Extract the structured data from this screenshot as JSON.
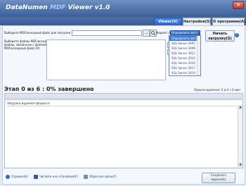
{
  "window": {
    "title_part1": "DataNumen ",
    "title_part2": "MDF",
    "title_part3": " Viewer v1.0",
    "close_label": "✕"
  },
  "tabs": [
    {
      "label": "Viewer(V)",
      "active": true
    },
    {
      "label": "Настройки(S)",
      "active": false
    },
    {
      "label": "О программе(A)",
      "active": false
    }
  ],
  "source": {
    "file_label": "Выберите MDF/исходный файл для загрузки (M):",
    "file_value": "",
    "browse_label": "...",
    "list_label_1": "Выберите файлы MDF/исходные",
    "list_label_2": "файлы, связанные с файлом",
    "list_label_3": "MDF/исходный файл (R):"
  },
  "format": {
    "label": "Формат (F):",
    "selected": "Определить авто",
    "options": [
      "Определить авто",
      "SQL Server 2005",
      "SQL Server 2008",
      "SQL Server 2012",
      "SQL Server 2014",
      "SQL Server 2016",
      "SQL Server 2017",
      "SQL Server 2019"
    ]
  },
  "actions": {
    "start_line1": "Начать",
    "start_line2": "загрузку(S)",
    "help_symbol": "?"
  },
  "progress": {
    "stage_text": "Этап 0 из 6 :  0% завершено",
    "time_text": "Прошло времени: 0 д 0 ч 0 мин",
    "percent": 0
  },
  "log": {
    "title": "Загрузка журнала процесса:"
  },
  "footer": {
    "help": "Справка(H)",
    "facebook": "Читайте нас в Facebook(F)",
    "feedback": "Обратная связь(F)",
    "save_line1": "Сохранить",
    "save_line2": "журнал(L)"
  },
  "colors": {
    "accent": "#3f7fd8",
    "titlebar": "#3a5f98"
  }
}
